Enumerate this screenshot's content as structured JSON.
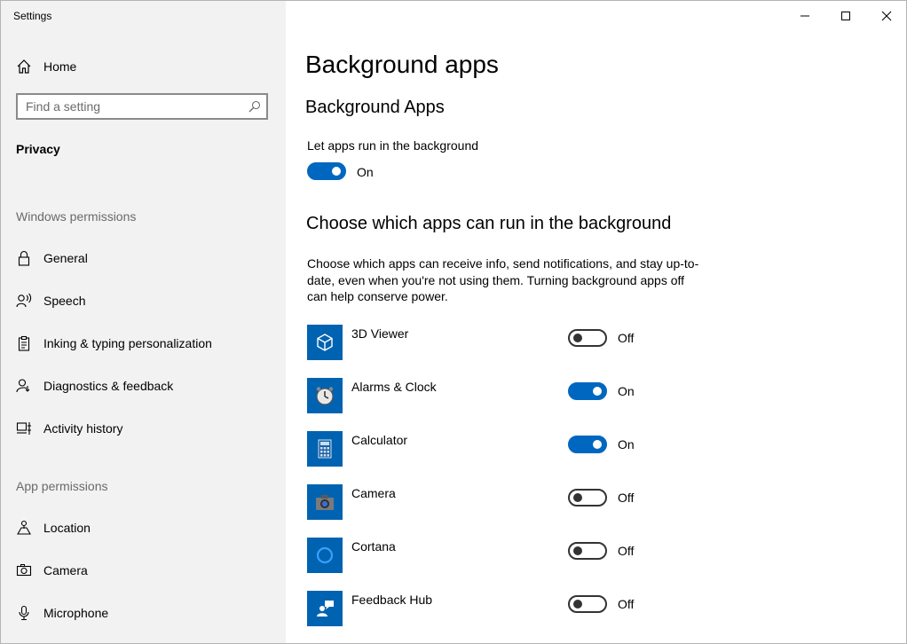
{
  "window": {
    "title": "Settings"
  },
  "sidebar": {
    "home_label": "Home",
    "search_placeholder": "Find a setting",
    "section": "Privacy",
    "windows_permissions_header": "Windows permissions",
    "windows_items": [
      {
        "label": "General",
        "icon": "lock-icon"
      },
      {
        "label": "Speech",
        "icon": "speech-icon"
      },
      {
        "label": "Inking & typing personalization",
        "icon": "clipboard-icon"
      },
      {
        "label": "Diagnostics & feedback",
        "icon": "diagnostics-icon"
      },
      {
        "label": "Activity history",
        "icon": "activity-history-icon"
      }
    ],
    "app_permissions_header": "App permissions",
    "app_items": [
      {
        "label": "Location",
        "icon": "location-icon"
      },
      {
        "label": "Camera",
        "icon": "camera-icon"
      },
      {
        "label": "Microphone",
        "icon": "microphone-icon"
      }
    ]
  },
  "main": {
    "title": "Background apps",
    "section_title": "Background Apps",
    "let_apps_label": "Let apps run in the background",
    "let_apps_state": "On",
    "choose_title": "Choose which apps can run in the background",
    "choose_desc": "Choose which apps can receive info, send notifications, and stay up-to-date, even when you're not using them. Turning background apps off can help conserve power.",
    "apps": [
      {
        "name": "3D Viewer",
        "state": "Off",
        "icon": "cube-icon"
      },
      {
        "name": "Alarms & Clock",
        "state": "On",
        "icon": "clock-icon"
      },
      {
        "name": "Calculator",
        "state": "On",
        "icon": "calculator-icon"
      },
      {
        "name": "Camera",
        "state": "Off",
        "icon": "camera-app-icon"
      },
      {
        "name": "Cortana",
        "state": "Off",
        "icon": "cortana-icon"
      },
      {
        "name": "Feedback Hub",
        "state": "Off",
        "icon": "feedback-hub-icon"
      }
    ]
  },
  "colors": {
    "accent": "#0067c0",
    "tile": "#0063b1",
    "sidebar_bg": "#f2f2f2"
  }
}
